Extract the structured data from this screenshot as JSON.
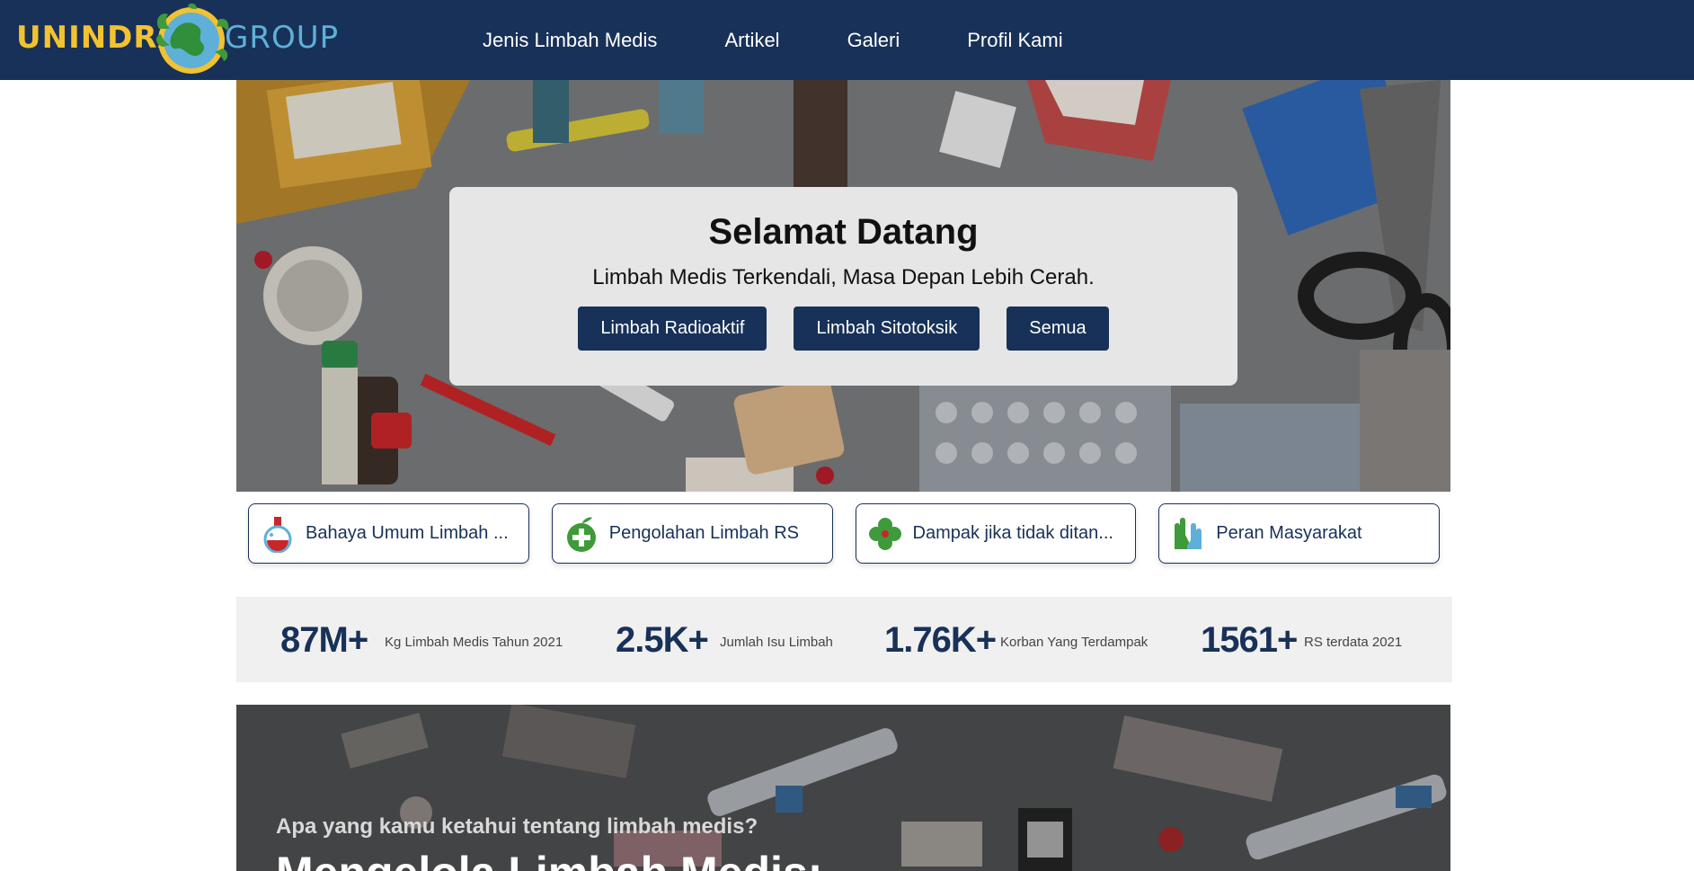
{
  "brand": {
    "left": "UNINDRA",
    "right": "GROUP",
    "colors": {
      "primary": "#183158",
      "accent": "#f2c230"
    }
  },
  "nav": [
    {
      "label": "Jenis Limbah Medis"
    },
    {
      "label": "Artikel"
    },
    {
      "label": "Galeri"
    },
    {
      "label": "Profil Kami"
    }
  ],
  "hero": {
    "title": "Selamat Datang",
    "subtitle": "Limbah Medis Terkendali, Masa Depan Lebih Cerah.",
    "buttons": [
      {
        "label": "Limbah Radioaktif"
      },
      {
        "label": "Limbah Sitotoksik"
      },
      {
        "label": "Semua"
      }
    ]
  },
  "categories": [
    {
      "label": "Bahaya Umum Limbah ...",
      "icon": "flask-icon"
    },
    {
      "label": "Pengolahan Limbah RS",
      "icon": "apple-medical-icon"
    },
    {
      "label": "Dampak jika tidak ditan...",
      "icon": "clover-icon"
    },
    {
      "label": "Peran Masyarakat",
      "icon": "hands-icon"
    }
  ],
  "stats": [
    {
      "value": "87M+",
      "label": "Kg Limbah Medis Tahun 2021"
    },
    {
      "value": "2.5K+",
      "label": "Jumlah Isu Limbah"
    },
    {
      "value": "1.76K+",
      "label": "Korban Yang Terdampak"
    },
    {
      "value": "1561+",
      "label": "RS terdata 2021"
    }
  ],
  "banner": {
    "kicker": "Apa yang kamu ketahui tentang limbah medis?",
    "title": "Mengelola Limbah Medis:"
  }
}
